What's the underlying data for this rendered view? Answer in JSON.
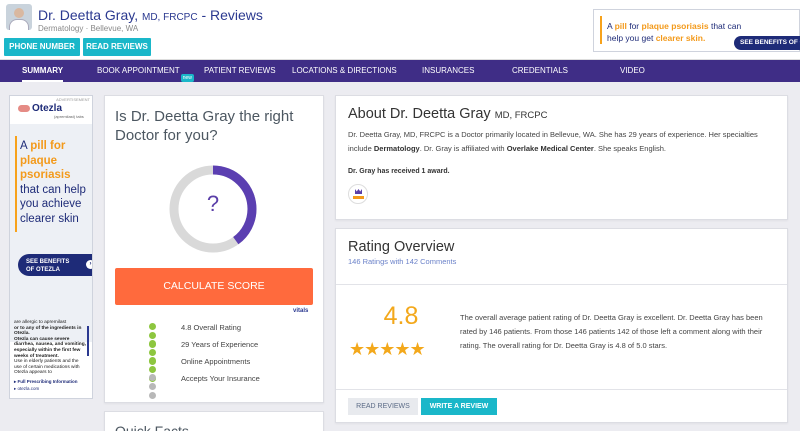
{
  "header": {
    "name": "Dr. Deetta Gray,",
    "credentials": "MD, FRCPC",
    "suffix": " - Reviews",
    "specialty_location": "Dermatology · Bellevue, WA",
    "phone_button": "PHONE NUMBER",
    "reviews_button": "READ REVIEWS"
  },
  "top_ad": {
    "text_pre": "A ",
    "text_pill": "pill",
    "text_mid": " for ",
    "text_psoriasis": "plaque psoriasis",
    "text_mid2": " that can help you get ",
    "text_clearer": "clearer skin.",
    "cta": "SEE BENEFITS OF O"
  },
  "nav": {
    "items": [
      "SUMMARY",
      "BOOK APPOINTMENT",
      "PATIENT REVIEWS",
      "LOCATIONS & DIRECTIONS",
      "INSURANCES",
      "CREDENTIALS",
      "VIDEO"
    ],
    "new_badge": "new"
  },
  "side_ad": {
    "advertisement": "ADVERTISEMENT",
    "brand": "Otezla",
    "brand_sub": "(apremilast) tabs",
    "headline_a": "A ",
    "headline_pill": "pill for plaque psoriasis",
    "headline_rest": " that can help you achieve clearer skin",
    "cta_line1": "SEE BENEFITS",
    "cta_line2": "OF OTEZLA",
    "cta_arrow": "›",
    "fine_1": "are allergic to apremilast",
    "fine_2": "or to any of the ingredients in Otezla.",
    "fine_3": "Otezla can cause severe diarrhea, nausea, and vomiting, especially within the first few weeks of treatment.",
    "fine_4": "Use in elderly patients and the use of certain medications with Otezla appears to",
    "link": "▸ Full Prescribing Information",
    "url": "▸ otezla.com"
  },
  "score_card": {
    "question": "Is Dr. Deetta Gray the right Doctor for you?",
    "ring_symbol": "?",
    "ring_fraction": 0.4,
    "calculate_button": "CALCULATE SCORE",
    "vitals": "vitals",
    "metrics": [
      {
        "label": "4.8 Overall Rating",
        "filled": 3
      },
      {
        "label": "29 Years of Experience",
        "filled": 3
      },
      {
        "label": "Online Appointments",
        "filled": 3
      },
      {
        "label": "Accepts Your Insurance",
        "filled": 0
      }
    ]
  },
  "quick_facts": {
    "title": "Quick Facts"
  },
  "about": {
    "title": "About Dr. Deetta Gray",
    "credentials": "MD, FRCPC",
    "text_1": "Dr. Deetta Gray, MD, FRCPC is a Doctor primarily located in Bellevue, WA. She has 29 years of experience. Her specialties include ",
    "specialty": "Dermatology",
    "text_2": ". Dr. Gray is affiliated with ",
    "affiliation": "Overlake Medical Center",
    "text_3": ". She speaks English.",
    "award_text": "Dr. Gray has received 1 award."
  },
  "rating": {
    "title": "Rating Overview",
    "subtitle": "146 Ratings with 142 Comments",
    "value": "4.8",
    "stars": "★★★★★",
    "star_value": 4.8,
    "text": "The overall average patient rating of Dr. Deetta Gray is excellent. Dr. Deetta Gray has been rated by 146 patients. From those 146 patients 142 of those left a comment along with their rating. The overall rating for Dr. Deetta Gray is 4.8 of 5.0 stars.",
    "read_button": "READ REVIEWS",
    "write_button": "WRITE A REVIEW"
  },
  "colors": {
    "nav_bg": "#3f2d86",
    "teal": "#1ab7c9",
    "orange_btn": "#ff6a3d",
    "star": "#f3a81b",
    "dot_green": "#8dc63f"
  }
}
